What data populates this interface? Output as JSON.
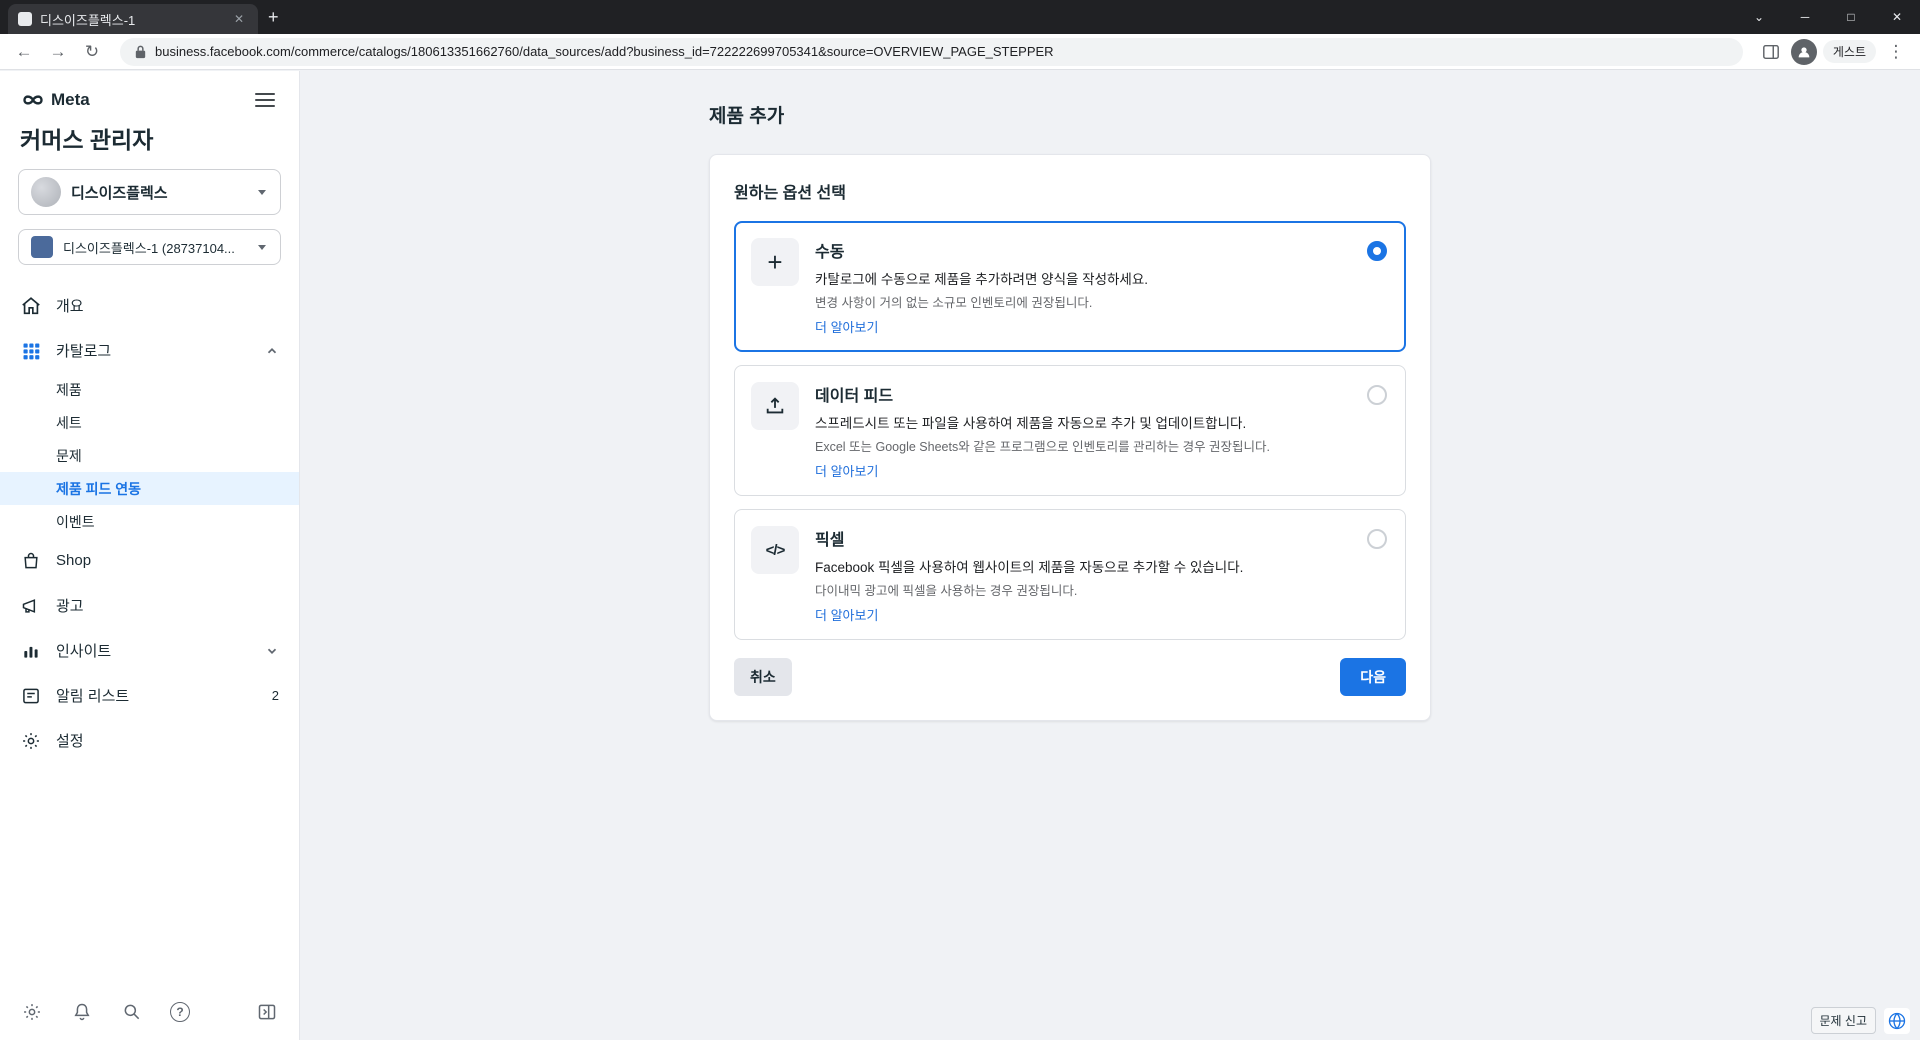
{
  "browser": {
    "tab_title": "디스이즈플렉스-1",
    "url": "business.facebook.com/commerce/catalogs/180613351662760/data_sources/add?business_id=722222699705341&source=OVERVIEW_PAGE_STEPPER",
    "profile_label": "게스트"
  },
  "window": {
    "tab_search": "⌄",
    "minimize": "─",
    "maximize": "□",
    "close": "✕",
    "new_tab": "+",
    "tab_close": "✕",
    "back": "←",
    "forward": "→",
    "reload": "↻",
    "menu": "⋮"
  },
  "sidebar": {
    "brand": "Meta",
    "title": "커머스 관리자",
    "business_name": "디스이즈플렉스",
    "catalog_name": "디스이즈플렉스-1 (28737104...",
    "nav_overview": "개요",
    "nav_catalog": "카탈로그",
    "catalog_children": [
      "제품",
      "세트",
      "문제",
      "제품 피드 연동",
      "이벤트"
    ],
    "nav_shop": "Shop",
    "nav_ads": "광고",
    "nav_insights": "인사이트",
    "nav_notifications": "알림 리스트",
    "notification_badge": "2",
    "nav_settings": "설정",
    "help_glyph": "?"
  },
  "main": {
    "page_title": "제품 추가",
    "card_title": "원하는 옵션 선택",
    "options": [
      {
        "icon_glyph": "+",
        "title": "수동",
        "desc1": "카탈로그에 수동으로 제품을 추가하려면 양식을 작성하세요.",
        "desc2": "변경 사항이 거의 없는 소규모 인벤토리에 권장됩니다.",
        "link": "더 알아보기"
      },
      {
        "icon_glyph": "",
        "title": "데이터 피드",
        "desc1": "스프레드시트 또는 파일을 사용하여 제품을 자동으로 추가 및 업데이트합니다.",
        "desc2": "Excel 또는 Google Sheets와 같은 프로그램으로 인벤토리를 관리하는 경우 권장됩니다.",
        "link": "더 알아보기"
      },
      {
        "icon_glyph": "</>",
        "title": "픽셀",
        "desc1": "Facebook 픽셀을 사용하여 웹사이트의 제품을 자동으로 추가할 수 있습니다.",
        "desc2": "다이내믹 광고에 픽셀을 사용하는 경우 권장됩니다.",
        "link": "더 알아보기"
      }
    ],
    "cancel_label": "취소",
    "next_label": "다음"
  },
  "footer": {
    "report_label": "문제 신고",
    "colors": {
      "accent": "#1b74e4",
      "active_bg": "#e7f3ff",
      "page_bg": "#f0f2f5"
    }
  }
}
